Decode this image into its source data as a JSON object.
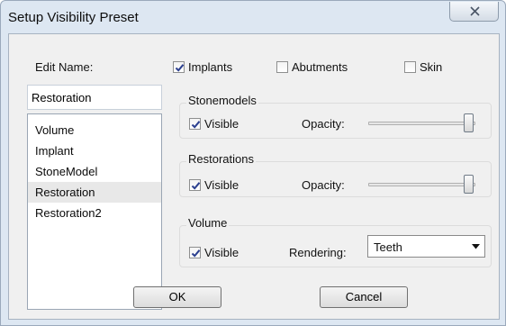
{
  "window": {
    "title": "Setup Visibility Preset"
  },
  "icons": {
    "close": "close-icon",
    "check": "check-icon",
    "dropdown": "chevron-down-icon"
  },
  "edit_name": {
    "label": "Edit Name:",
    "value": "Restoration"
  },
  "preset_list": {
    "items": [
      "Volume",
      "Implant",
      "StoneModel",
      "Restoration",
      "Restoration2"
    ],
    "selected": "Restoration"
  },
  "toggles": {
    "implants": {
      "label": "Implants",
      "checked": true
    },
    "abutments": {
      "label": "Abutments",
      "checked": false
    },
    "skin": {
      "label": "Skin",
      "checked": false
    }
  },
  "stonemodels": {
    "title": "Stonemodels",
    "visible_label": "Visible",
    "visible_checked": true,
    "opacity_label": "Opacity:",
    "opacity_level": 1.0
  },
  "restorations": {
    "title": "Restorations",
    "visible_label": "Visible",
    "visible_checked": true,
    "opacity_label": "Opacity:",
    "opacity_level": 1.0
  },
  "volume": {
    "title": "Volume",
    "visible_label": "Visible",
    "visible_checked": true,
    "rendering_label": "Rendering:",
    "rendering_value": "Teeth"
  },
  "buttons": {
    "ok": "OK",
    "cancel": "Cancel"
  }
}
